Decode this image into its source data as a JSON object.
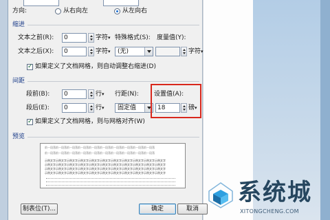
{
  "direction": {
    "label": "方向:",
    "rtl": "从右向左",
    "ltr": "从左向右"
  },
  "indent": {
    "title": "缩进",
    "before_label": "文本之前",
    "before_key": "(R):",
    "before_value": "0",
    "before_unit": "字符",
    "after_label": "文本之后",
    "after_key": "(X):",
    "after_value": "0",
    "after_unit": "字符",
    "special_label": "特殊格式(S):",
    "special_value": "(无)",
    "measure_label": "度量值(Y):",
    "measure_value": "",
    "measure_unit": "字符",
    "grid_checkbox": "如果定义了文档网格，则自动调整右缩进(D)"
  },
  "spacing": {
    "title": "间距",
    "before_label": "段前",
    "before_key": "(B):",
    "before_value": "0",
    "before_unit": "行",
    "after_label": "段后",
    "after_key": "(E):",
    "after_value": "0",
    "after_unit": "行",
    "line_label": "行距(N):",
    "line_value": "固定值",
    "setting_label": "设置值(A):",
    "setting_value": "18",
    "setting_unit": "磅",
    "grid_checkbox": "如果定义了文档网格，则与网格对齐(W)"
  },
  "preview": {
    "title": "预览",
    "sample_text": "前一段落前一段落前一段落前一段落前一段落前一段落前一段落前一段落前一段落前一段落",
    "sample_body": "示例文字示例文字示例文字示例文字示例文字示例文字示例文字示例文字示例文字示例文字示例文字"
  },
  "buttons": {
    "tabs": "制表位(T)...",
    "ok": "确定",
    "cancel": "取消"
  },
  "watermark": {
    "text": "系统城",
    "url": "XITONGCHENG.COM"
  },
  "colors": {
    "highlight": "#d8271c",
    "section_title": "#1d3e8a",
    "watermark": "#26465f"
  }
}
